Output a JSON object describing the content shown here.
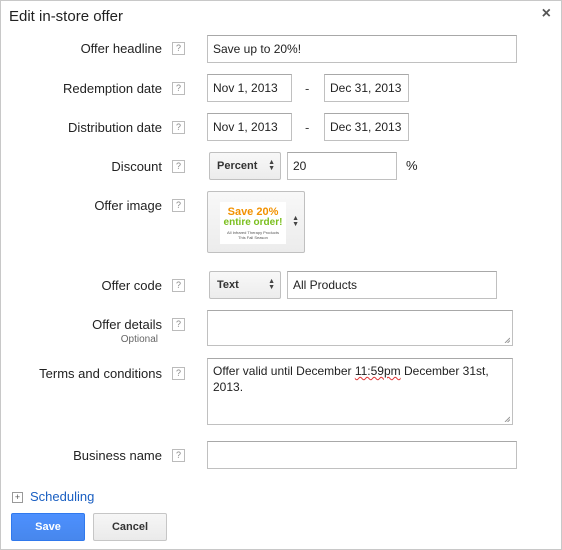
{
  "dialog": {
    "title": "Edit in-store offer",
    "close_glyph": "×"
  },
  "help_glyph": "?",
  "offer_headline": {
    "label": "Offer headline",
    "value": "Save up to 20%!"
  },
  "redemption_date": {
    "label": "Redemption date",
    "start": "Nov 1, 2013",
    "separator": "-",
    "end": "Dec 31, 2013"
  },
  "distribution_date": {
    "label": "Distribution date",
    "start": "Nov 1, 2013",
    "separator": "-",
    "end": "Dec 31, 2013"
  },
  "discount": {
    "label": "Discount",
    "type": "Percent",
    "value": "20",
    "unit": "%"
  },
  "offer_image": {
    "label": "Offer image",
    "line1": "Save 20%",
    "line2": "entire order!",
    "line3": "All Infrared Therapy Products",
    "line4": "This Fall Season"
  },
  "offer_code": {
    "label": "Offer code",
    "type": "Text",
    "value": "All Products"
  },
  "offer_details": {
    "label": "Offer details",
    "sublabel": "Optional",
    "value": ""
  },
  "terms": {
    "label": "Terms and conditions",
    "value_part1": "Offer valid until December ",
    "value_misspelled": "11:59pm",
    "value_part2": " December 31st, 2013."
  },
  "business_name": {
    "label": "Business name",
    "value": ""
  },
  "scheduling": {
    "toggle": "+",
    "label": "Scheduling"
  },
  "buttons": {
    "save": "Save",
    "cancel": "Cancel"
  },
  "colors": {
    "accent": "#4d90fe",
    "link": "#1a5fc2",
    "thumb_orange": "#f29100",
    "thumb_green": "#7bbf1f"
  }
}
